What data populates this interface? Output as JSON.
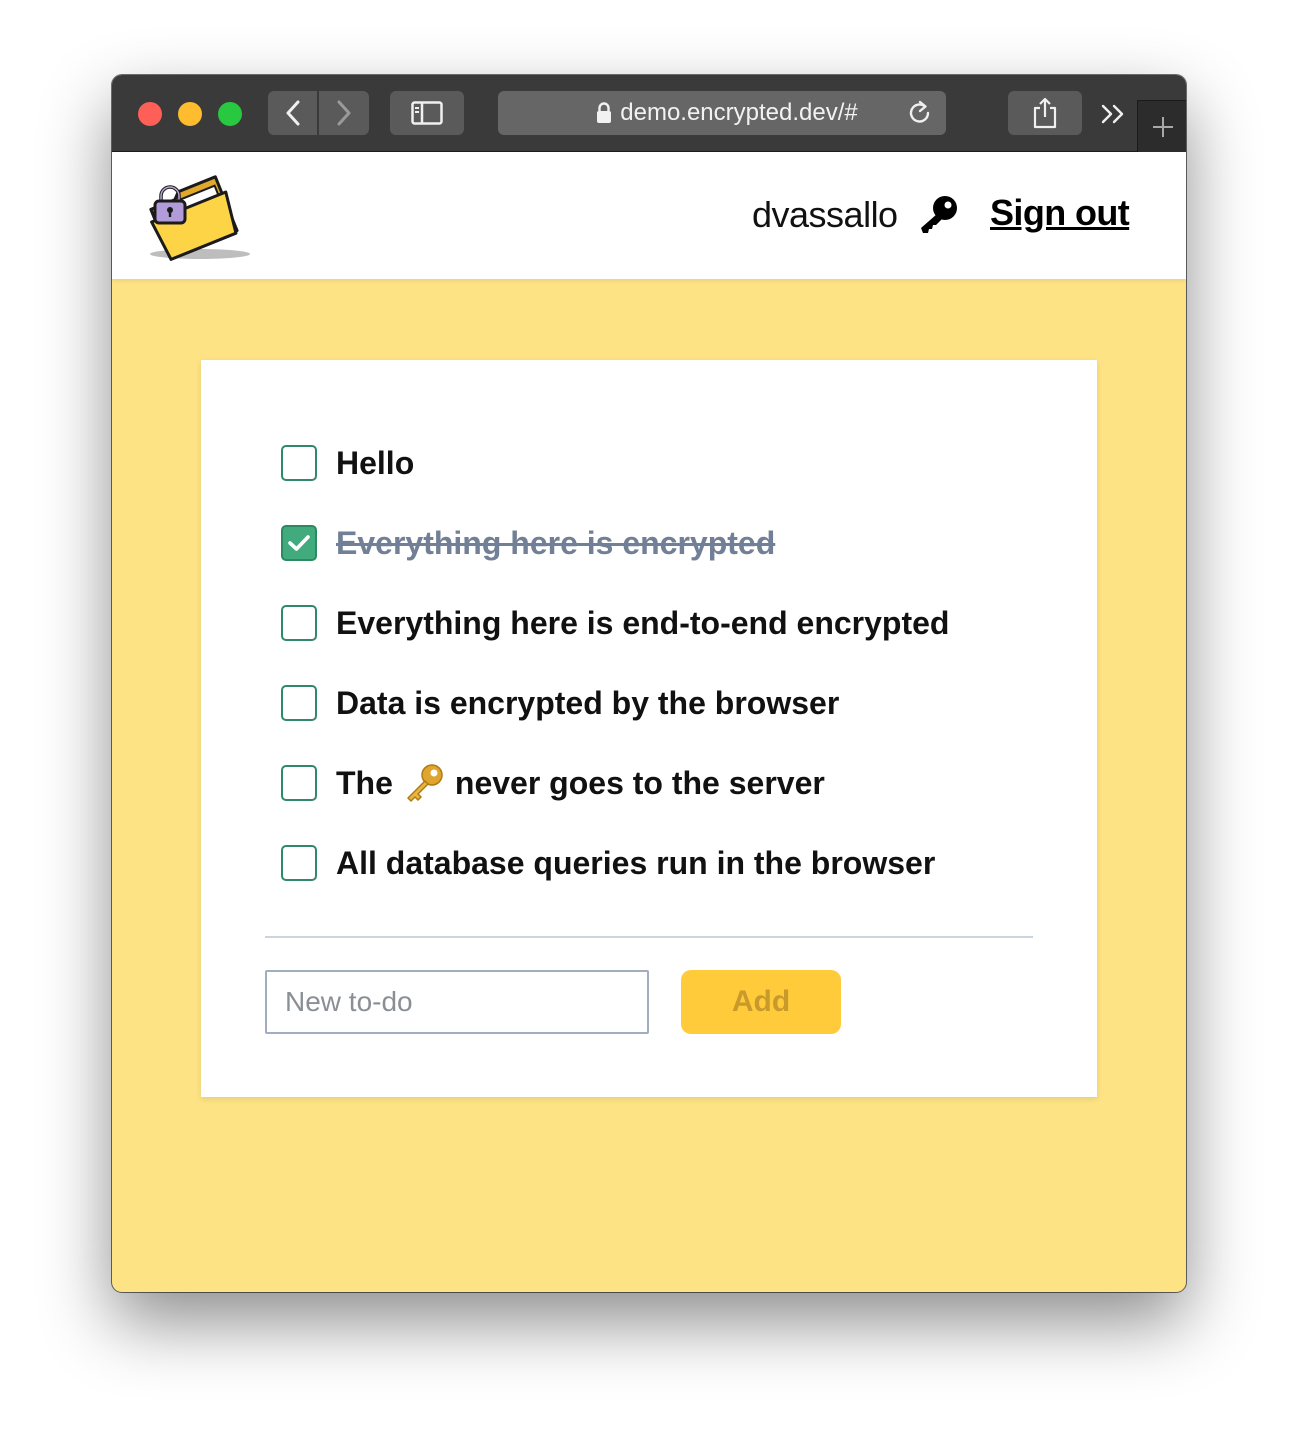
{
  "browser": {
    "url": "demo.encrypted.dev/#",
    "back_icon": "chevron-left-icon",
    "forward_icon": "chevron-right-icon",
    "sidebar_icon": "sidebar-icon",
    "lock_icon": "lock-icon",
    "reload_icon": "reload-icon",
    "share_icon": "share-icon",
    "more_icon": "double-chevron-right-icon",
    "new_tab_icon": "plus-icon"
  },
  "header": {
    "logo_icon": "locked-folder-icon",
    "username": "dvassallo",
    "key_icon": "key-icon",
    "signout_label": "Sign out"
  },
  "todos": [
    {
      "text": "Hello",
      "done": false
    },
    {
      "text": "Everything here is encrypted",
      "done": true
    },
    {
      "text": "Everything here is end-to-end encrypted",
      "done": false
    },
    {
      "text": "Data is encrypted by the browser",
      "done": false
    },
    {
      "text_before": "The",
      "emoji_icon": "key-emoji-icon",
      "text_after": "never goes to the server",
      "done": false
    },
    {
      "text": "All database queries run in the browser",
      "done": false
    }
  ],
  "new_todo": {
    "placeholder": "New to-do",
    "value": ""
  },
  "add_button": {
    "label": "Add"
  },
  "colors": {
    "page_background": "#fee384",
    "checkbox_border": "#2f8a67",
    "checkbox_checked": "#42ab7e",
    "done_text": "#718096",
    "add_button_bg": "#ffcb3b",
    "add_button_text": "#c89a2b"
  }
}
